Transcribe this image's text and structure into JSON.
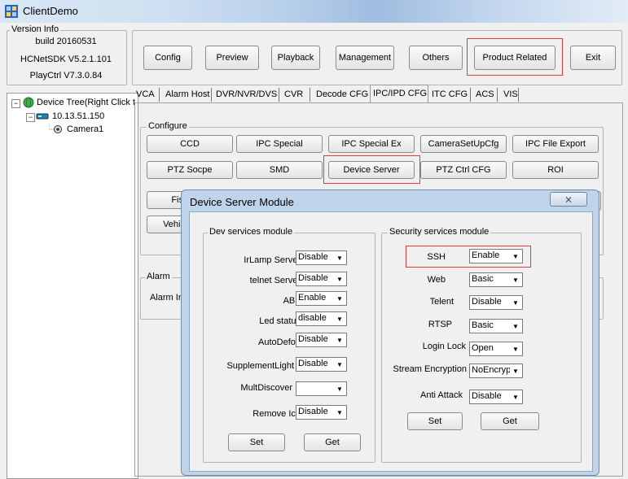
{
  "window": {
    "title": "ClientDemo"
  },
  "version": {
    "group_label": "Version Info",
    "build": "build 20160531",
    "sdk": "HCNetSDK V5.2.1.101",
    "playctrl": "PlayCtrl V7.3.0.84"
  },
  "toolbar": {
    "config": "Config",
    "preview": "Preview",
    "playback": "Playback",
    "management": "Management",
    "others": "Others",
    "product_related": "Product Related",
    "exit": "Exit"
  },
  "tree": {
    "root": "Device Tree(Right Click t",
    "device": "10.13.51.150",
    "camera": "Camera1"
  },
  "tabs": [
    "VCA",
    "Alarm Host",
    "DVR/NVR/DVS",
    "CVR",
    "Decode CFG",
    "IPC/IPD CFG",
    "ITC CFG",
    "ACS",
    "VIS"
  ],
  "configure": {
    "label": "Configure",
    "row1": [
      "CCD",
      "IPC Special",
      "IPC Special Ex",
      "CameraSetUpCfg",
      "IPC File Export"
    ],
    "row2": [
      "PTZ Socpe",
      "SMD",
      "Device Server",
      "PTZ Ctrl CFG",
      "ROI"
    ],
    "partial1": "Fis",
    "partial2": "Vehic"
  },
  "alarm": {
    "label": "Alarm",
    "alarm_in": "Alarm In"
  },
  "dialog": {
    "title": "Device Server Module",
    "close": "⨯",
    "dev": {
      "label": "Dev services module",
      "fields": [
        {
          "label": "IrLamp Server",
          "value": "Disable"
        },
        {
          "label": "telnet Server",
          "value": "Disable"
        },
        {
          "label": "ABF",
          "value": "Enable"
        },
        {
          "label": "Led status",
          "value": "disable"
        },
        {
          "label": "AutoDefog",
          "value": "Disable"
        },
        {
          "label": "SupplementLight",
          "value": "Disable"
        },
        {
          "label": "MultDiscover",
          "value": ""
        },
        {
          "label": "Remove Ice",
          "value": "Disable"
        }
      ],
      "set": "Set",
      "get": "Get"
    },
    "sec": {
      "label": "Security services module",
      "fields": [
        {
          "label": "SSH",
          "value": "Enable"
        },
        {
          "label": "Web",
          "value": "Basic"
        },
        {
          "label": "Telent",
          "value": "Disable"
        },
        {
          "label": "RTSP",
          "value": "Basic"
        },
        {
          "label": "Login Lock",
          "value": "Open"
        },
        {
          "label": "Stream Encryption",
          "value": "NoEncrypt"
        },
        {
          "label": "Anti Attack",
          "value": "Disable"
        }
      ],
      "set": "Set",
      "get": "Get"
    }
  },
  "colors": {
    "highlight": "#e03a3a",
    "dialog_frame": "#bfd4ea"
  }
}
